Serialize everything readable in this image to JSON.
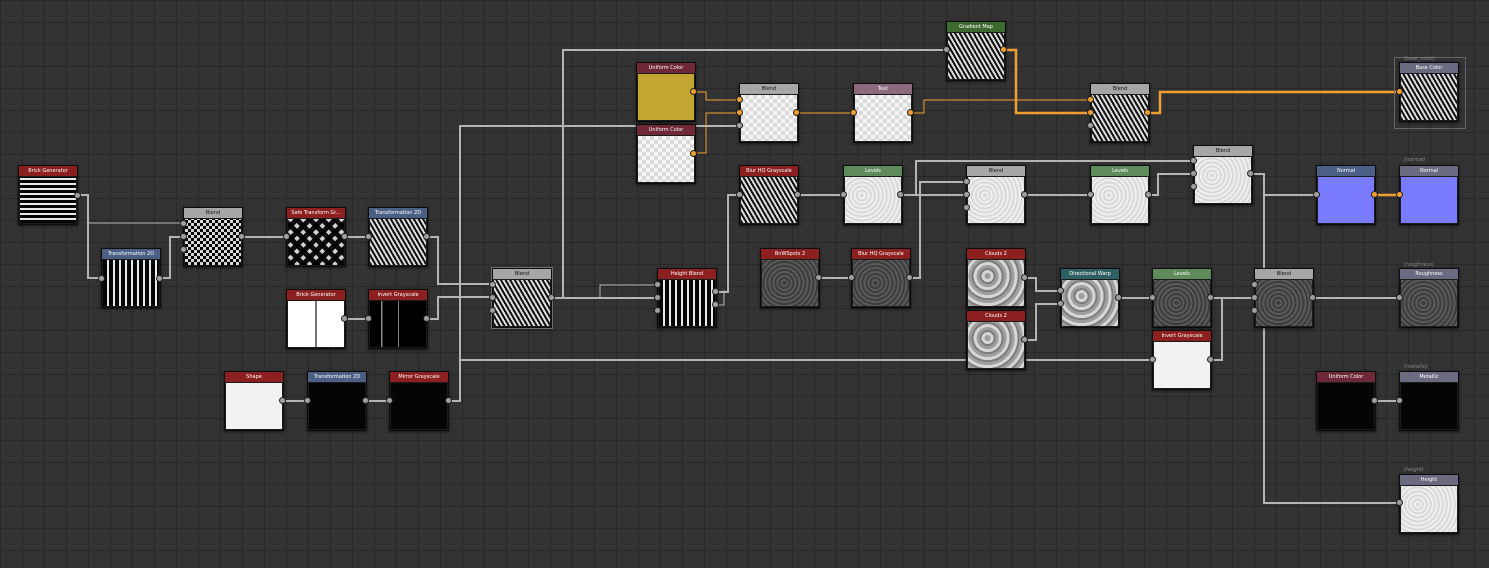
{
  "colors": {
    "canvas": "#333333",
    "wire_grey": "#b4b4b4",
    "wire_orange": "#f0a030"
  },
  "nodes": {
    "n_brick1": {
      "label": "Brick Generator"
    },
    "n_trans1": {
      "label": "Transformation 2D"
    },
    "n_blend1": {
      "label": "Blend"
    },
    "n_safe": {
      "label": "Safe Transform Gr..."
    },
    "n_trans2": {
      "label": "Transformation 2D"
    },
    "n_brick2": {
      "label": "Brick Generator"
    },
    "n_invert1": {
      "label": "Invert Grayscale"
    },
    "n_shape": {
      "label": "Shape"
    },
    "n_trans3": {
      "label": "Transformation 2D"
    },
    "n_mirror": {
      "label": "Mirror Grayscale"
    },
    "n_blend2": {
      "label": "Blend"
    },
    "n_uni1": {
      "label": "Uniform Color"
    },
    "n_uni2": {
      "label": "Uniform Color"
    },
    "n_blend3": {
      "label": "Blend"
    },
    "n_text": {
      "label": "Text"
    },
    "n_gradmap": {
      "label": "Gradient Map"
    },
    "n_blend4": {
      "label": "Blend"
    },
    "n_blurhq1": {
      "label": "Blur HQ Grayscale"
    },
    "n_levels1": {
      "label": "Levels"
    },
    "n_height": {
      "label": "Height Blend"
    },
    "n_bnw": {
      "label": "BnWSpots 2"
    },
    "n_blurhq2": {
      "label": "Blur HQ Grayscale"
    },
    "n_blend5": {
      "label": "Blend"
    },
    "n_levels2": {
      "label": "Levels"
    },
    "n_blend6": {
      "label": "Blend"
    },
    "n_clouds1": {
      "label": "Clouds 2"
    },
    "n_clouds2": {
      "label": "Clouds 2"
    },
    "n_dirwarp": {
      "label": "Directional Warp"
    },
    "n_levels3": {
      "label": "Levels"
    },
    "n_invert2": {
      "label": "Invert Grayscale"
    },
    "n_blend7": {
      "label": "Blend"
    },
    "n_normal": {
      "label": "Normal"
    },
    "n_uni3": {
      "label": "Uniform Color"
    },
    "o_base": {
      "label": "Base Color",
      "frame": "(base_color)"
    },
    "o_normal": {
      "label": "Normal",
      "frame": "(normal)"
    },
    "o_rough": {
      "label": "Roughness",
      "frame": "(roughness)"
    },
    "o_metal": {
      "label": "Metallic",
      "frame": "(metallic)"
    },
    "o_height": {
      "label": "Height",
      "frame": "(height)"
    }
  }
}
